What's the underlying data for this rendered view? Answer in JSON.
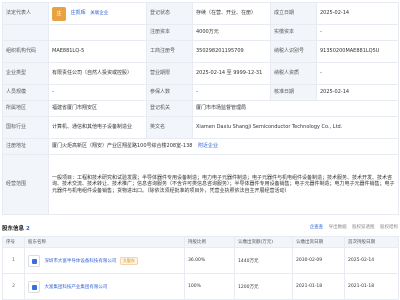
{
  "rows": [
    {
      "l1": "法定代表人",
      "rep_avatar": "庄",
      "rep_name": "庄凯晖",
      "rep_tag": "关联企业",
      "l2": "登记状态",
      "v2": "存续（在营、开业、在册）",
      "l3": "成立日期",
      "v3": "2025-02-14"
    },
    {
      "l2": "注册资本",
      "v2": "4000万元",
      "l3": "实缴资本",
      "v3": "-"
    },
    {
      "l1": "组织机构代码",
      "v1": "MAE881LQ-5",
      "l2": "工商注册号",
      "v2": "350298201195709",
      "l3": "纳税人识别号",
      "v3": "91350200MAE881LQ5U"
    },
    {
      "l1": "企业类型",
      "v1": "有限责任公司（自然人投资或控股）",
      "l2": "营业期限",
      "v2": "2025-02-14 至 9999-12-31",
      "l3": "纳税人资质",
      "v3": "-"
    },
    {
      "l1": "人员规模",
      "v1": "-",
      "l2": "参保人数",
      "v2": "-",
      "l3": "核准日期",
      "v3": "2025-02-14"
    },
    {
      "l1": "所属地区",
      "v1": "福建省厦门市翔安区",
      "l2": "登记机关",
      "v2": "厦门市市场监督管理局"
    },
    {
      "l1": "国标行业",
      "v1": "计算机、通信和其他电子设备制造业",
      "l2": "英文名",
      "v2": "Xiamen Daxiu Shangji Semiconductor Technology Co., Ltd."
    },
    {
      "l1": "注册地址",
      "v1": "厦门火炬高新区（翔安）产业区翔星路100号综合楼208室-138",
      "tag": "附近企业"
    },
    {
      "l1": "经营范围",
      "v1": "一般项目：工程和技术研究和试验发展；半导体器件专用设备制造；电力电子元器件制造；电子元器件与机电组件设备制造；技术服务、技术开发、技术咨询、技术交流、技术转让、技术推广；信息咨询服务（不含许可类信息咨询服务）；半导体器件专用设备销售；电子元器件制造；电力电子元器件销售；电子元器件与机电组件设备销售；货物进出口。（除依法须经批准的项目外，凭营业执照依法自主开展经营活动）"
    }
  ],
  "shareholders_header": {
    "title": "股东信息",
    "count": "2",
    "right_items": [
      "企查查",
      "导出数据",
      "股权穿透图",
      "股权结构"
    ]
  },
  "inv_headers": [
    "序号",
    "股东名称",
    "持股比例",
    "认缴出资额(万元)",
    "认缴出资日期",
    "首次持股日期"
  ],
  "inv_rows": [
    {
      "num": "1",
      "name": "深圳市大富半导体设备科技有限公司",
      "badge": "大股东",
      "ratio": "36.00%",
      "amount": "1440万元",
      "date": "2030-02-09",
      "first": "2025-02-14"
    },
    {
      "num": "2",
      "name": "大富集团科技产业集团有限公司",
      "badge": "",
      "ratio": "100%",
      "amount": "1200万元",
      "date": "2021-01-18",
      "first": "2021-01-18"
    }
  ]
}
